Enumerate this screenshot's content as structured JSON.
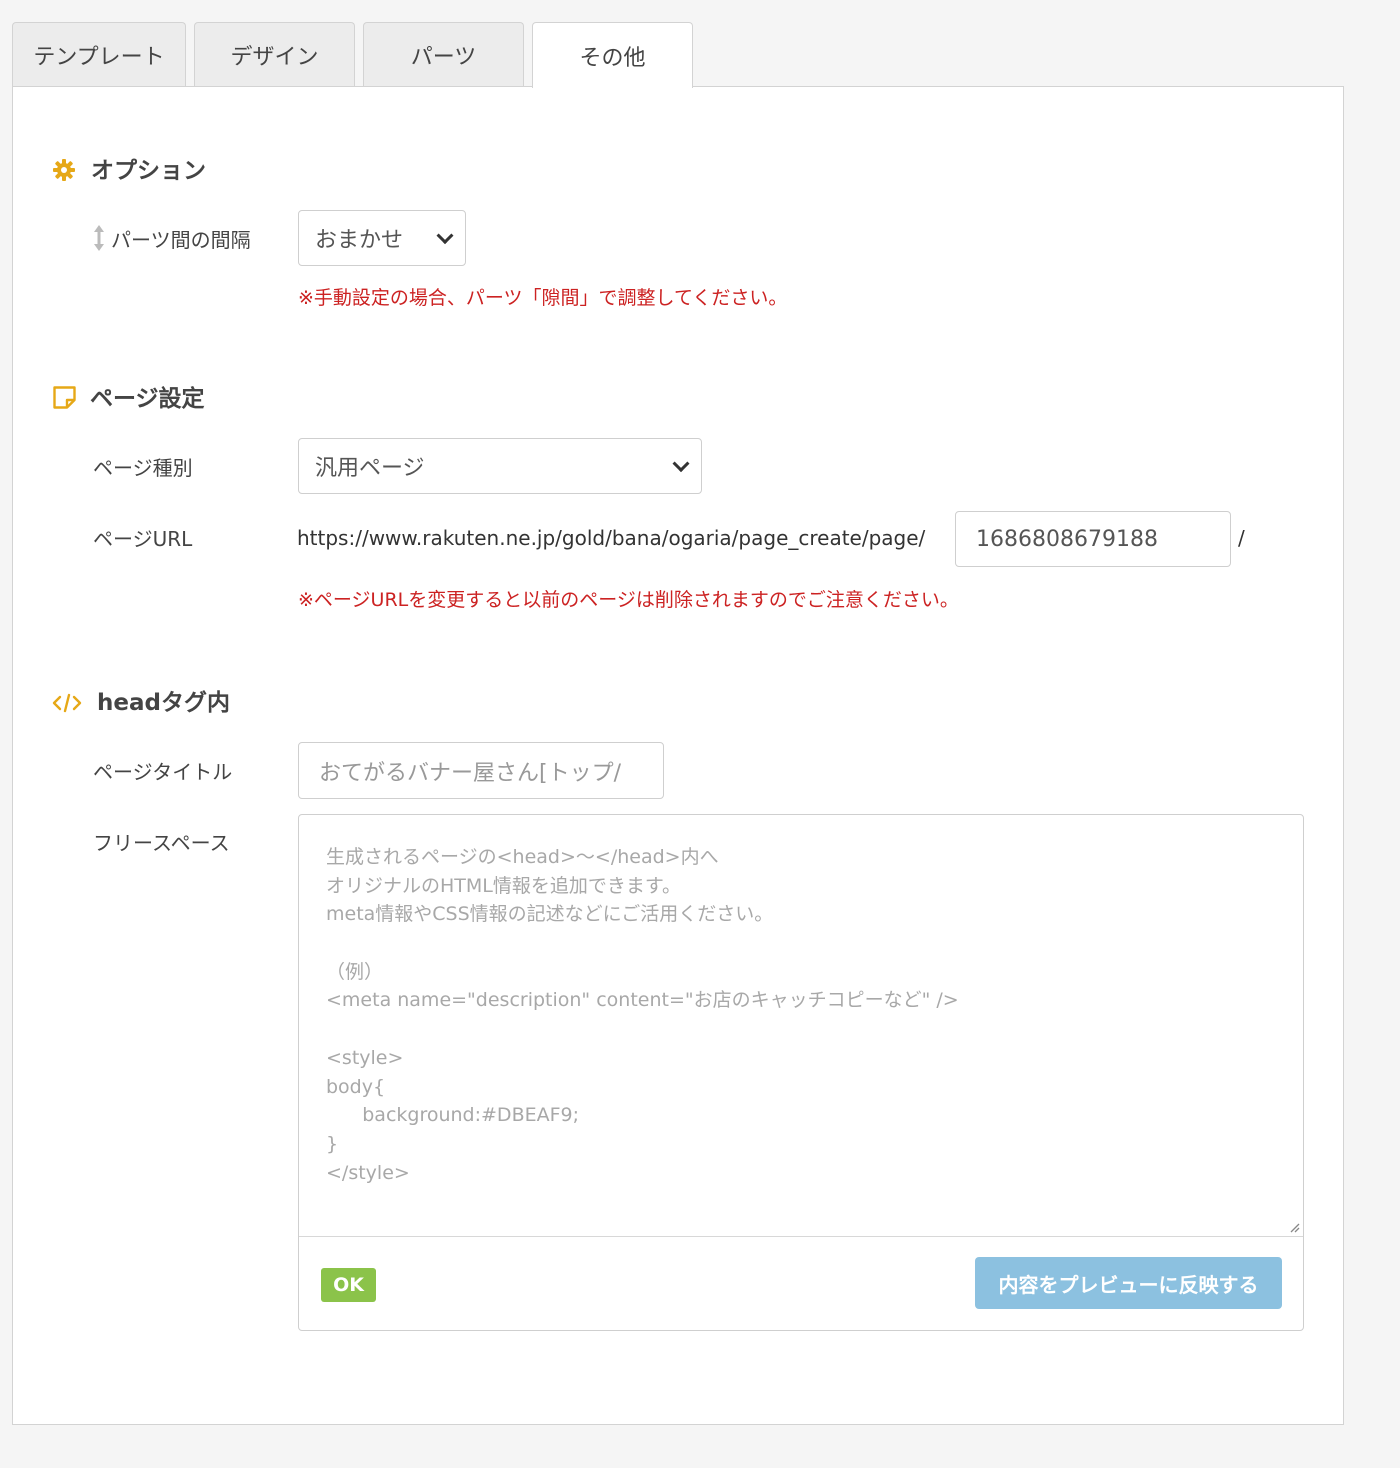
{
  "tabs": [
    {
      "label": "テンプレート"
    },
    {
      "label": "デザイン"
    },
    {
      "label": "パーツ"
    },
    {
      "label": "その他"
    }
  ],
  "options_section": {
    "title": "オプション",
    "spacing_label": "パーツ間の間隔",
    "spacing_value": "おまかせ",
    "spacing_note": "※手動設定の場合、パーツ「隙間」で調整してください。"
  },
  "page_section": {
    "title": "ページ設定",
    "type_label": "ページ種別",
    "type_value": "汎用ページ",
    "url_label": "ページURL",
    "url_prefix": "https://www.rakuten.ne.jp/gold/bana/ogaria/page_create/page/",
    "url_value": "1686808679188",
    "url_suffix": "/",
    "url_note": "※ページURLを変更すると以前のページは削除されますのでご注意ください。"
  },
  "head_section": {
    "title": "headタグ内",
    "page_title_label": "ページタイトル",
    "page_title_placeholder": "おてがるバナー屋さん[トップ/",
    "free_space_label": "フリースペース",
    "free_space_placeholder_lines": [
      "生成されるページの<head>〜</head>内へ",
      "オリジナルのHTML情報を追加できます。",
      "meta情報やCSS情報の記述などにご活用ください。",
      "",
      "（例）",
      "<meta name=\"description\" content=\"お店のキャッチコピーなど\" />",
      "",
      "<style>",
      "body{",
      "      background:#DBEAF9;",
      "}",
      "</style>"
    ],
    "ok_label": "OK",
    "preview_button_label": "内容をプレビューに反映する"
  },
  "colors": {
    "icon_accent": "#e6a817",
    "warning_text": "#cc2222",
    "ok_badge": "#8bc34a",
    "preview_button": "#8cc1e0"
  }
}
